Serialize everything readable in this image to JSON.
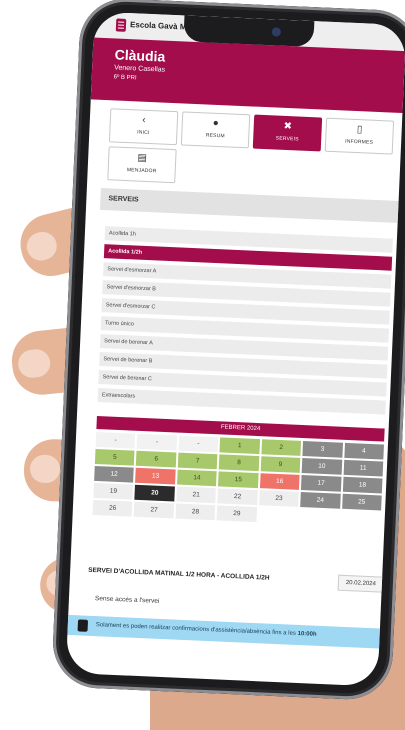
{
  "app": {
    "title": "Escola Gavà Mar"
  },
  "student": {
    "name": "Clàudia",
    "surname": "Venero Casellas",
    "class": "6º B PRI"
  },
  "tiles": [
    {
      "icon": "chevron-left-icon",
      "glyph": "‹",
      "label": "INICI"
    },
    {
      "icon": "person-icon",
      "glyph": "●",
      "label": "RESUM"
    },
    {
      "icon": "tools-icon",
      "glyph": "✖",
      "label": "SERVEIS"
    },
    {
      "icon": "document-icon",
      "glyph": "▯",
      "label": "INFORMES"
    },
    {
      "icon": "calendar-icon",
      "glyph": "▤",
      "label": "MENJADOR"
    }
  ],
  "section": {
    "title": "SERVEIS"
  },
  "services": [
    "Acollida 1h",
    "Acollida 1/2h",
    "Servei d'esmorzar A",
    "Servei d'esmorzar B",
    "Servei d'esmorzar C",
    "Turno único",
    "Servei de berenar A",
    "Servei de berenar B",
    "Servei de berenar C",
    "Extraescolars"
  ],
  "selected_service": "Acollida 1/2h",
  "calendar": {
    "month": "FEBRER 2024",
    "days": [
      {
        "d": "-",
        "s": "light"
      },
      {
        "d": "-",
        "s": "light"
      },
      {
        "d": "-",
        "s": "light"
      },
      {
        "d": "1",
        "s": "green"
      },
      {
        "d": "2",
        "s": "green"
      },
      {
        "d": "3",
        "s": "grey"
      },
      {
        "d": "4",
        "s": "grey"
      },
      {
        "d": "5",
        "s": "green"
      },
      {
        "d": "6",
        "s": "green"
      },
      {
        "d": "7",
        "s": "green"
      },
      {
        "d": "8",
        "s": "green"
      },
      {
        "d": "9",
        "s": "green"
      },
      {
        "d": "10",
        "s": "grey"
      },
      {
        "d": "11",
        "s": "grey"
      },
      {
        "d": "12",
        "s": "grey"
      },
      {
        "d": "13",
        "s": "red"
      },
      {
        "d": "14",
        "s": "green"
      },
      {
        "d": "15",
        "s": "green"
      },
      {
        "d": "16",
        "s": "red"
      },
      {
        "d": "17",
        "s": "grey"
      },
      {
        "d": "18",
        "s": "grey"
      },
      {
        "d": "19",
        "s": "plain"
      },
      {
        "d": "20",
        "s": "today"
      },
      {
        "d": "21",
        "s": "plain"
      },
      {
        "d": "22",
        "s": "plain"
      },
      {
        "d": "23",
        "s": "plain"
      },
      {
        "d": "24",
        "s": "grey"
      },
      {
        "d": "25",
        "s": "grey"
      },
      {
        "d": "26",
        "s": "plain"
      },
      {
        "d": "27",
        "s": "plain"
      },
      {
        "d": "28",
        "s": "plain"
      },
      {
        "d": "29",
        "s": "plain"
      }
    ]
  },
  "detail": {
    "title": "SERVEI D'ACOLLIDA MATINAL 1/2 HORA - ACOLLIDA 1/2H",
    "date": "20.02.2024",
    "no_access": "Sense accés a l'servei"
  },
  "notice": {
    "text": "Solament es poden realitzar confirmacions d'assistència/absència fins a les",
    "time": "10:00h"
  },
  "colors": {
    "brand": "#a30d4b",
    "green": "#a7c96b",
    "red": "#f0736a",
    "grey": "#8a8a8a",
    "info": "#9fd8f3"
  }
}
